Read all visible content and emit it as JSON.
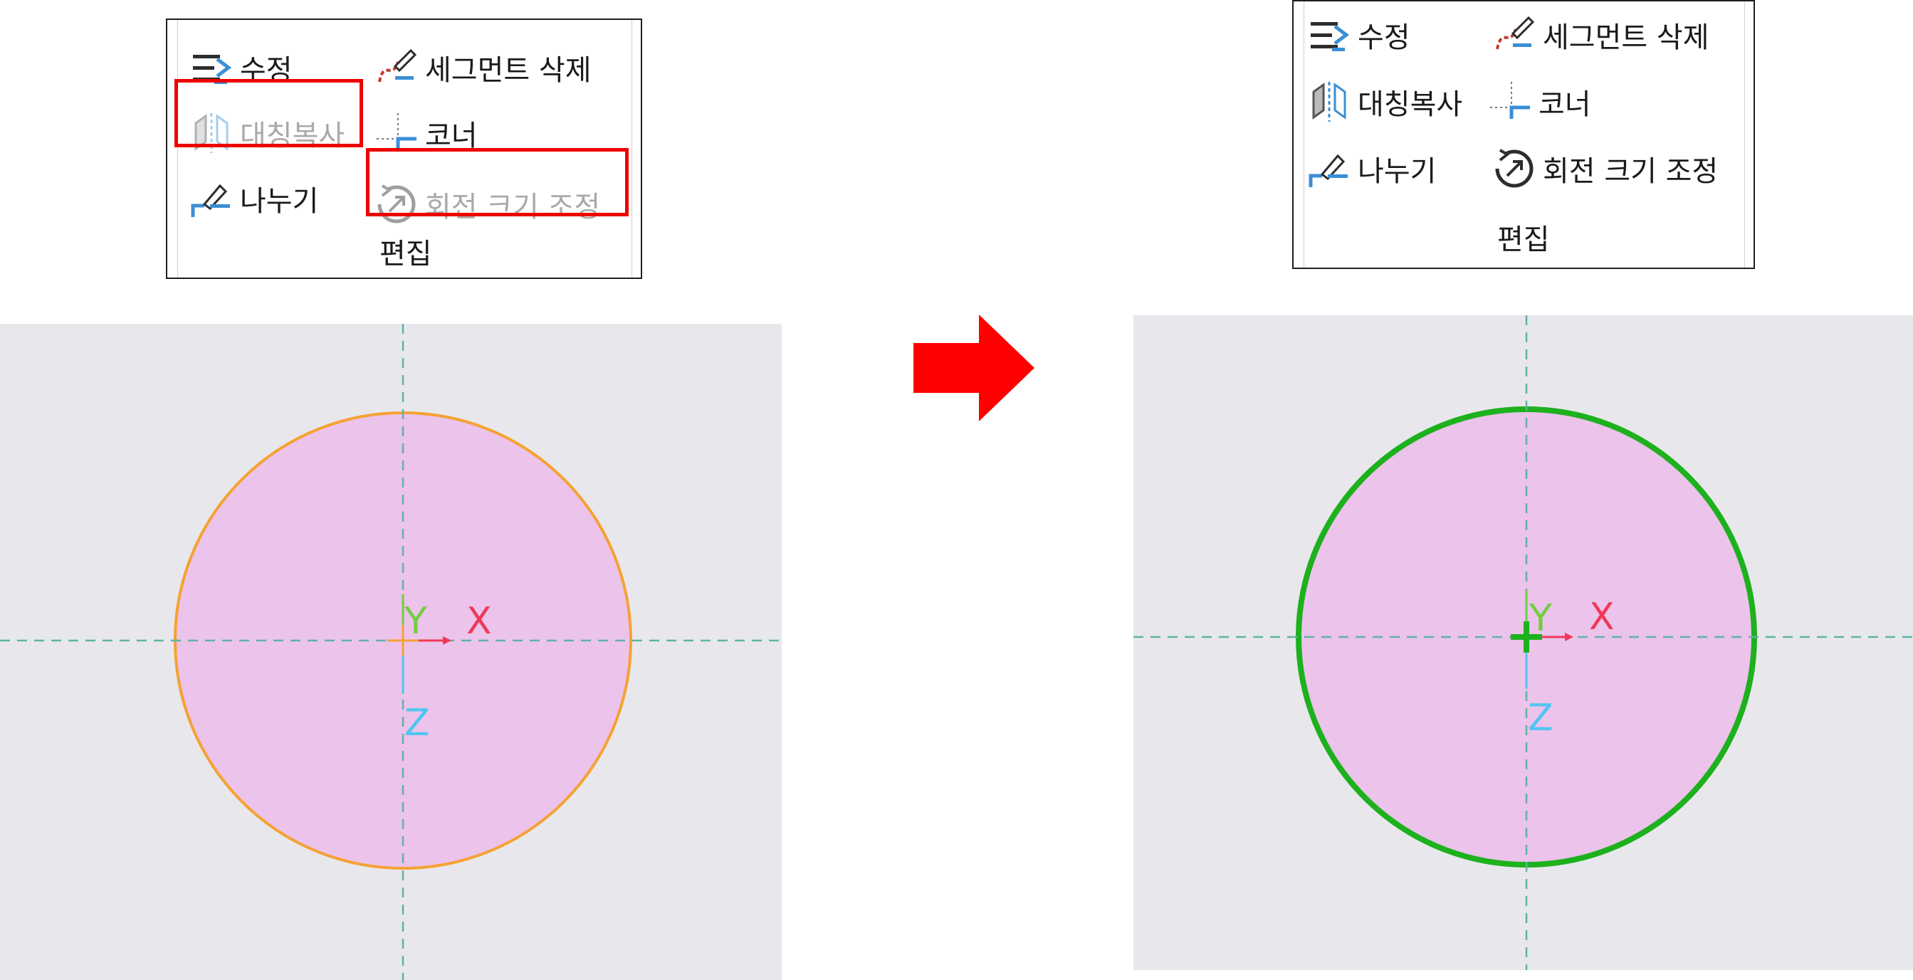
{
  "before_panel": {
    "modify": "수정",
    "delete_segment": "세그먼트 삭제",
    "mirror": "대칭복사",
    "corner": "코너",
    "divide": "나누기",
    "rotate_resize": "회전 크기 조정",
    "group": "편집",
    "disabled_tools": [
      "대칭복사",
      "회전 크기 조정"
    ],
    "highlighted_tools": [
      "대칭복사",
      "회전 크기 조정"
    ]
  },
  "after_panel": {
    "modify": "수정",
    "delete_segment": "세그먼트 삭제",
    "mirror": "대칭복사",
    "corner": "코너",
    "divide": "나누기",
    "rotate_resize": "회전 크기 조정",
    "group": "편집"
  },
  "before_view": {
    "axis_x": "X",
    "axis_y": "Y",
    "axis_z": "Z",
    "circle_stroke": "#f5a233",
    "circle_fill": "#ecc3ea"
  },
  "after_view": {
    "axis_x": "X",
    "axis_y": "Y",
    "axis_z": "Z",
    "circle_stroke": "#1db11d",
    "circle_fill": "#ecc3ea"
  },
  "transition": {
    "icon": "right-arrow-icon",
    "color": "#ff0000"
  },
  "colors": {
    "highlight": "#ee0000",
    "canvas_bg": "#e8e8ec",
    "centerline": "#5fb3a6",
    "axis_x": "#f0385a",
    "axis_y": "#6fcf3f",
    "axis_z": "#4fc6f0"
  }
}
